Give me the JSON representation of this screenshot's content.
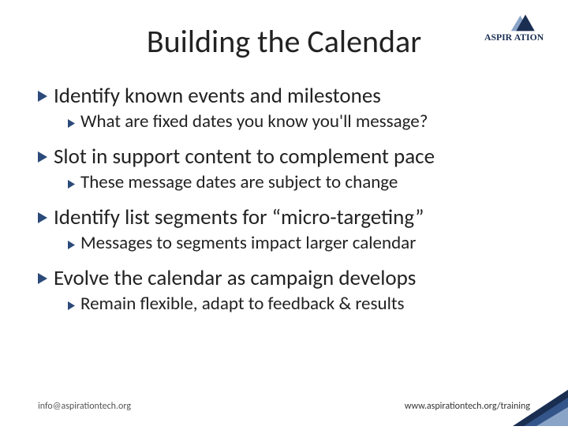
{
  "title": "Building the Calendar",
  "brand": "ASPIRATION",
  "bullets": [
    {
      "text": "Identify known events and milestones",
      "sub": "What are fixed dates you know you'll message?"
    },
    {
      "text": "Slot in support content to complement pace",
      "sub": "These message dates are subject to change"
    },
    {
      "text": "Identify list segments for “micro-targeting”",
      "sub": "Messages to segments impact larger calendar"
    },
    {
      "text": "Evolve the calendar as campaign develops",
      "sub": "Remain flexible, adapt to feedback & results"
    }
  ],
  "footer": {
    "left": "info@aspirationtech.org",
    "right": "www.aspirationtech.org/training"
  },
  "colors": {
    "bullet": "#2b4a7a",
    "logo_dark": "#1a2e52",
    "logo_light": "#8aa4c8"
  }
}
